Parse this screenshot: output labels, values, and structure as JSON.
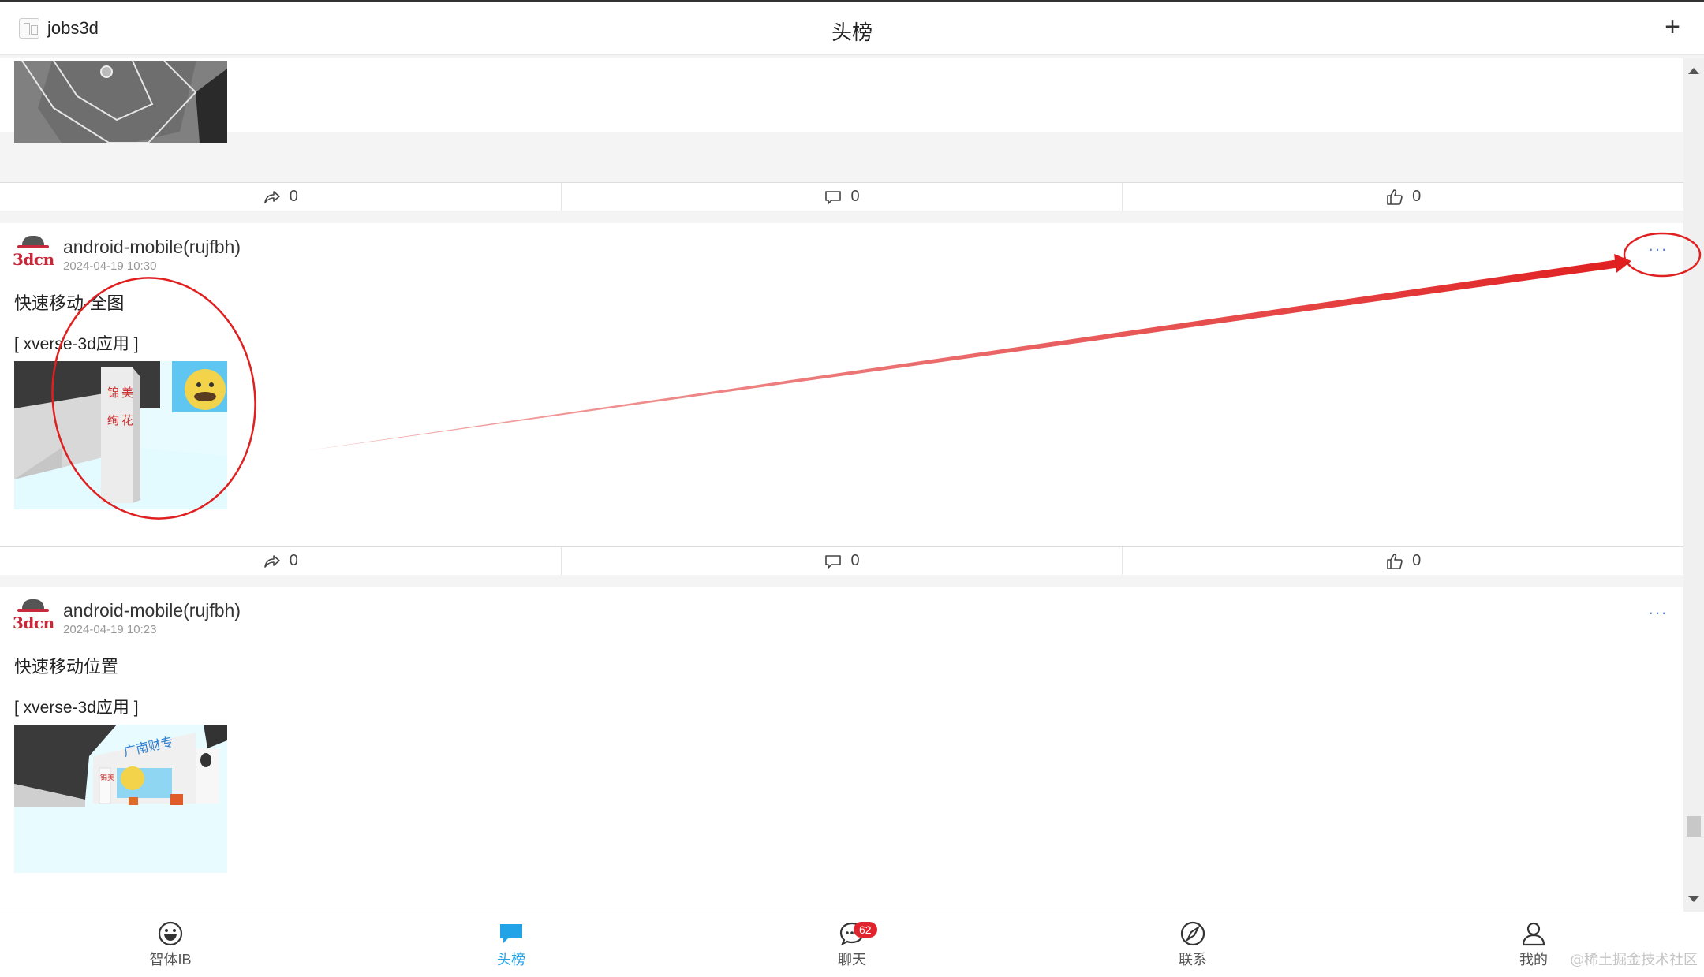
{
  "header": {
    "username": "jobs3d",
    "title": "头榜",
    "add_label": "+"
  },
  "logo_text": "3dcn",
  "top_post": {
    "actions": {
      "shares": "0",
      "comments": "0",
      "likes": "0"
    }
  },
  "posts": [
    {
      "author": "android-mobile(rujfbh)",
      "time": "2024-04-19 10:30",
      "text": "快速移动-全图",
      "tag": "[ xverse-3d应用 ]",
      "more": "···",
      "actions": {
        "shares": "0",
        "comments": "0",
        "likes": "0"
      }
    },
    {
      "author": "android-mobile(rujfbh)",
      "time": "2024-04-19 10:23",
      "text": "快速移动位置",
      "tag": "[ xverse-3d应用 ]",
      "more": "···"
    }
  ],
  "bottom_nav": [
    {
      "label": "智体IB",
      "icon": "smiley-icon"
    },
    {
      "label": "头榜",
      "icon": "chat-bubble-icon",
      "active": true
    },
    {
      "label": "聊天",
      "icon": "chat-icon",
      "badge": "62"
    },
    {
      "label": "联系",
      "icon": "compass-icon"
    },
    {
      "label": "我的",
      "icon": "person-icon"
    }
  ],
  "watermark": "@稀土掘金技术社区",
  "colors": {
    "accent": "#22a3e8",
    "badge": "#e0232c",
    "annotation": "#e02020",
    "brand": "#c8283a"
  }
}
